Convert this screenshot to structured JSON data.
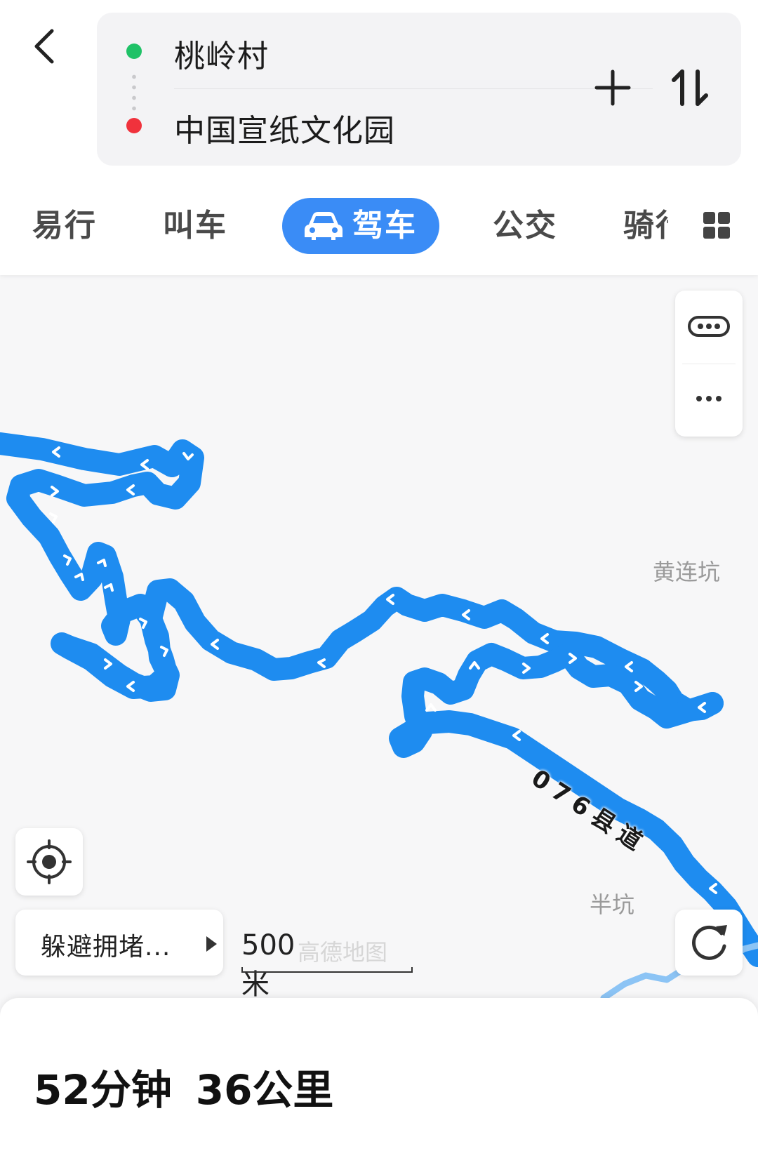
{
  "route": {
    "start": "桃岭村",
    "end": "中国宣纸文化园"
  },
  "modes": [
    "易行",
    "叫车",
    "驾车",
    "公交",
    "骑行"
  ],
  "active_mode": "驾车",
  "map": {
    "labels": {
      "village1": "黄连坑",
      "village2": "半坑"
    },
    "road_label": "076县道",
    "scale": "500米",
    "watermark": "高德地图",
    "route_color": "#1e8cf0"
  },
  "avoid_congestion": "躲避拥堵...",
  "summary": {
    "duration": "52分钟",
    "distance": "36公里"
  }
}
